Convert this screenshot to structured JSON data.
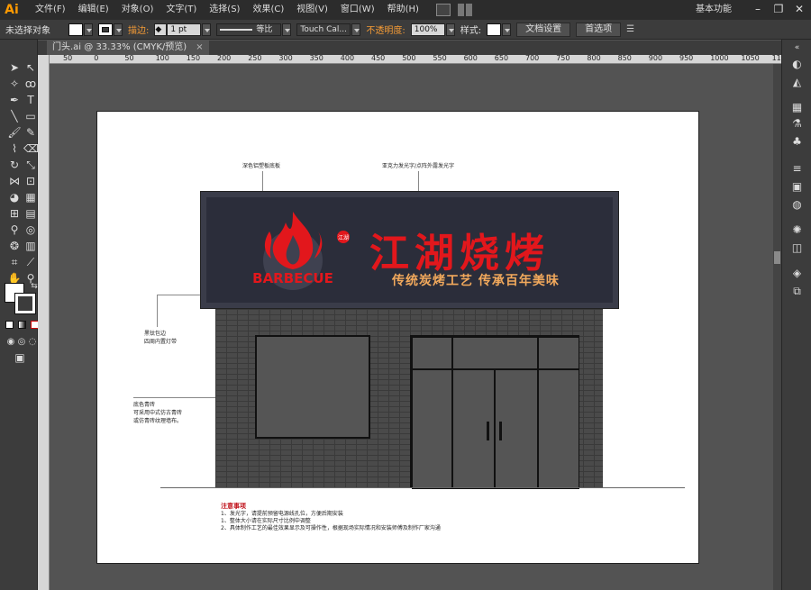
{
  "app": {
    "logo": "Ai"
  },
  "menu": [
    "文件(F)",
    "编辑(E)",
    "对象(O)",
    "文字(T)",
    "选择(S)",
    "效果(C)",
    "视图(V)",
    "窗口(W)",
    "帮助(H)"
  ],
  "workspace": "基本功能",
  "window_controls": {
    "minimize": "–",
    "restore": "❐",
    "close": "✕"
  },
  "control_bar": {
    "selection_status": "未选择对象",
    "stroke_label": "描边:",
    "stroke_weight": "1 pt",
    "stroke_profile": "等比",
    "brush": "Touch Cal...",
    "opacity_label": "不透明度:",
    "opacity_value": "100%",
    "style_label": "样式:",
    "doc_setup_button": "文档设置",
    "preferences_button": "首选项",
    "colors": {
      "fill": "#ffffff",
      "accent": "#f49b36"
    }
  },
  "document_tab": {
    "title": "门头.ai @ 33.33% (CMYK/预览)",
    "close": "×"
  },
  "ruler_labels": [
    "50",
    "0",
    "50",
    "100",
    "150",
    "200",
    "250",
    "300",
    "350",
    "400",
    "450",
    "500",
    "550",
    "600",
    "650",
    "700",
    "750",
    "800",
    "850",
    "900",
    "950",
    "1000",
    "1050",
    "1100"
  ],
  "artwork": {
    "annotations": {
      "signboard_base": "深色铝塑板底板",
      "lettering": "亚克力发光字/点阵外露发光字",
      "trim": [
        "黑钛包边",
        "四周内置灯带"
      ],
      "wall": [
        "底色青砖",
        "可采用中式仿古青砖",
        "或仿青砖纹理墙布。"
      ]
    },
    "sign": {
      "title": "江湖烧烤",
      "subtitle": "传统炭烤工艺 传承百年美味",
      "logo_text": "BARBECUE",
      "seal_text": "江湖",
      "colors": {
        "title": "#e2171c",
        "subtitle": "#f2a95c",
        "board": "#2b2d3a"
      }
    },
    "notes": {
      "title": "注意事项",
      "items": [
        "1、发光字，请提前预留电源线孔位，方便后期安装",
        "1、整体大小请在实际尺寸比例中调整",
        "2、具体制作工艺的最佳效果显示及可操作性，根据现场实际情况和安装师傅及制作厂家沟通"
      ]
    }
  }
}
